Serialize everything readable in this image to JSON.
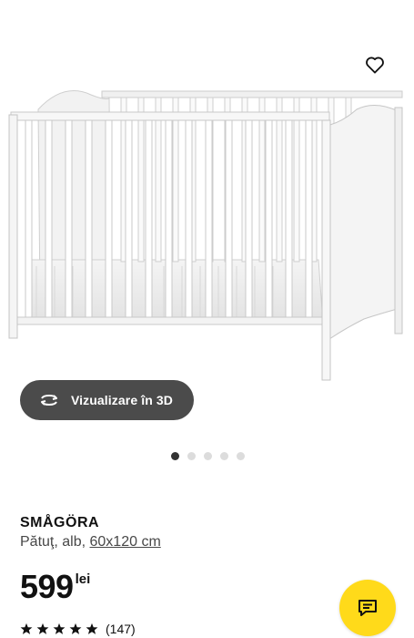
{
  "gallery": {
    "image_alt": "Pătuţ SMÅGÖRA alb",
    "favorite_icon": "heart-outline-icon",
    "view3d": {
      "label": "Vizualizare în 3D",
      "icon": "rotate-3d-icon"
    },
    "dots": {
      "total": 5,
      "active_index": 0
    }
  },
  "product": {
    "name": "SMÅGÖRA",
    "desc_prefix": "Pătuţ, alb, ",
    "size": "60x120 cm",
    "price": "599",
    "currency": "lei",
    "rating": {
      "stars": 5,
      "count_label": "(147)"
    }
  },
  "chat": {
    "icon": "chat-bubble-icon",
    "color": "#ffda1a"
  },
  "colors": {
    "view3d_bg": "#4b4b4b",
    "chat_bg": "#ffda1a",
    "dot_active": "#333333",
    "dot_inactive": "#dcdcdc"
  }
}
